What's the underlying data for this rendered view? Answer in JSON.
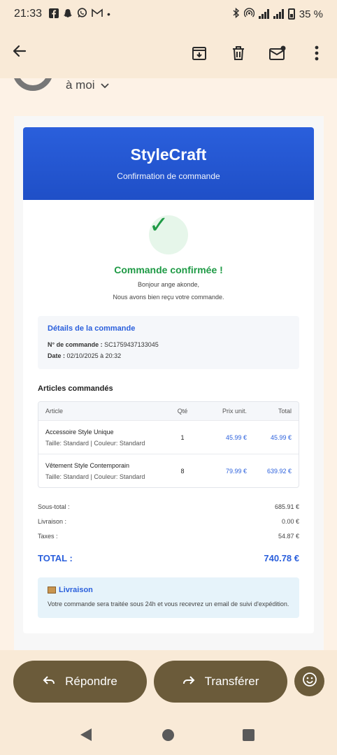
{
  "status": {
    "time": "21:33",
    "notif_icons": [
      "facebook-icon",
      "snapchat-icon",
      "whatsapp-icon",
      "gmail-icon"
    ],
    "battery": "35 %"
  },
  "appbar": {
    "icons": [
      "back-arrow-icon",
      "archive-icon",
      "delete-icon",
      "mark-unread-icon",
      "more-icon"
    ]
  },
  "sender": {
    "to_label": "à moi"
  },
  "email": {
    "brand": "StyleCraft",
    "brand_sub": "Confirmation de commande",
    "confirmed": "Commande confirmée !",
    "greeting": "Bonjour ange akonde,",
    "received": "Nous avons bien reçu votre commande.",
    "details": {
      "title": "Détails de la commande",
      "order_label": "N° de commande :",
      "order_value": "SC1759437133045",
      "date_label": "Date :",
      "date_value": "02/10/2025 à 20:32"
    },
    "articles_title": "Articles commandés",
    "table": {
      "headers": {
        "article": "Article",
        "qty": "Qté",
        "unit": "Prix unit.",
        "total": "Total"
      },
      "rows": [
        {
          "name": "Accessoire Style Unique",
          "meta": "Taille: Standard | Couleur: Standard",
          "qty": "1",
          "unit": "45.99 €",
          "total": "45.99 €"
        },
        {
          "name": "Vêtement Style Contemporain",
          "meta": "Taille: Standard | Couleur: Standard",
          "qty": "8",
          "unit": "79.99 €",
          "total": "639.92 €"
        }
      ]
    },
    "sums": {
      "subtotal_label": "Sous-total :",
      "subtotal": "685.91 €",
      "shipping_label": "Livraison :",
      "shipping": "0.00 €",
      "tax_label": "Taxes :",
      "tax": "54.87 €"
    },
    "total_label": "TOTAL :",
    "total": "740.78 €",
    "delivery": {
      "title": "Livraison",
      "text": "Votre commande sera traitée sous 24h et vous recevrez un email de suivi d'expédition."
    }
  },
  "actions": {
    "reply": "Répondre",
    "forward": "Transférer"
  },
  "colors": {
    "brand_blue": "#2a5fdc",
    "success_green": "#1e9a45",
    "pill": "#6b5b3a"
  }
}
